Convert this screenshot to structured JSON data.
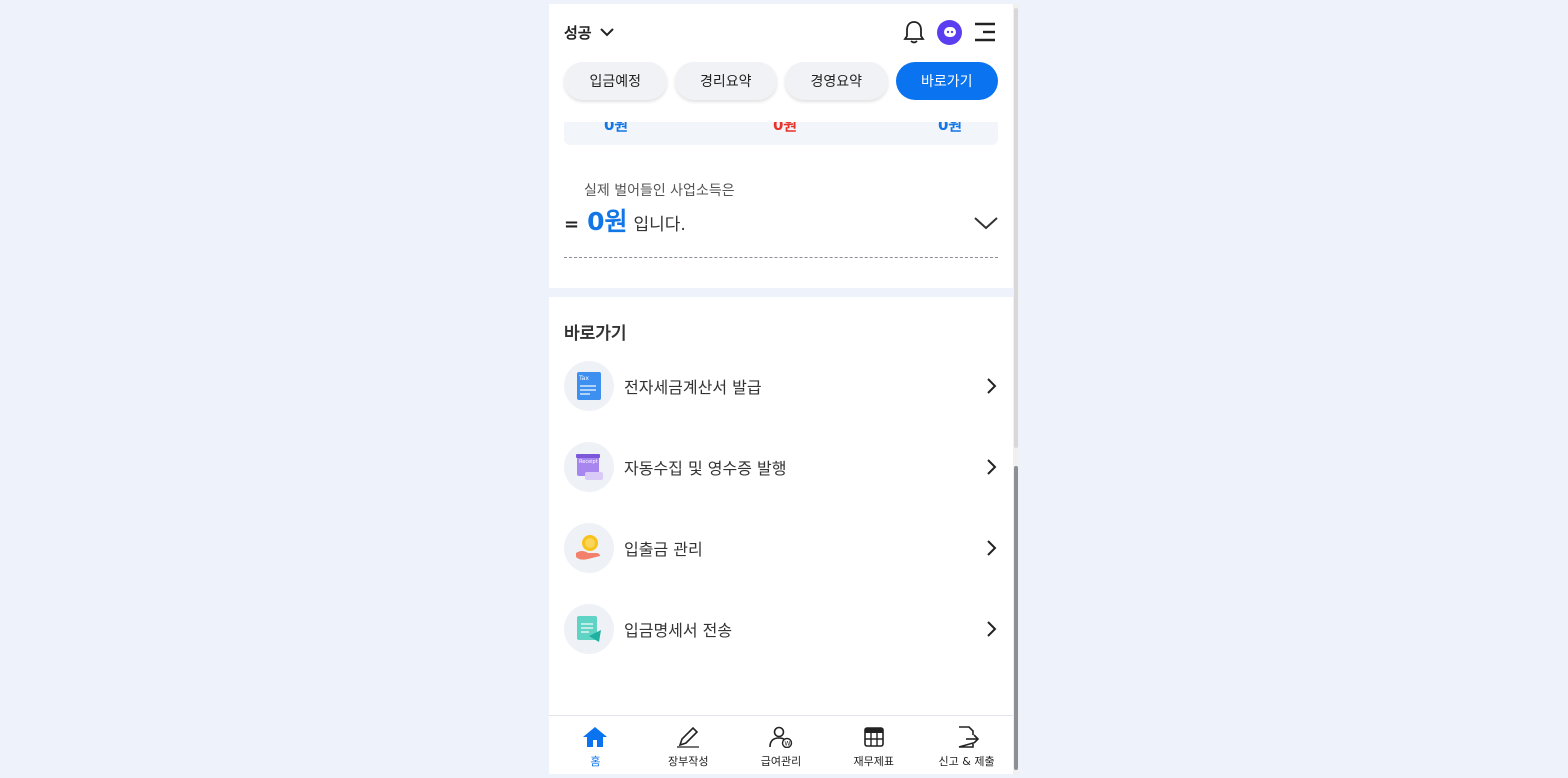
{
  "header": {
    "business_name": "성공"
  },
  "tabs": [
    {
      "label": "입금예정"
    },
    {
      "label": "경리요약"
    },
    {
      "label": "경영요약"
    },
    {
      "label": "바로가기",
      "active": true
    }
  ],
  "summary": {
    "values": [
      "0원",
      "0원",
      "0원"
    ],
    "colors": [
      "#1276e6",
      "#e8332b",
      "#1276e6"
    ]
  },
  "income": {
    "label": "실제 벌어들인 사업소득은",
    "eq": "=",
    "amount": "0원",
    "suffix": "입니다."
  },
  "shortcuts": {
    "title": "바로가기",
    "items": [
      {
        "label": "전자세금계산서 발급",
        "icon": "tax-invoice-icon"
      },
      {
        "label": "자동수집 및 영수증 발행",
        "icon": "receipt-icon"
      },
      {
        "label": "입출금 관리",
        "icon": "coin-hand-icon"
      },
      {
        "label": "입금명세서 전송",
        "icon": "deposit-statement-icon"
      }
    ]
  },
  "nav": [
    {
      "label": "홈",
      "icon": "home-icon",
      "active": true
    },
    {
      "label": "장부작성",
      "icon": "pencil-icon"
    },
    {
      "label": "급여관리",
      "icon": "payroll-icon"
    },
    {
      "label": "재무제표",
      "icon": "table-icon"
    },
    {
      "label": "신고 & 제출",
      "icon": "file-export-icon"
    }
  ],
  "colors": {
    "accent": "#0a74f0",
    "background": "#eef2fb"
  }
}
